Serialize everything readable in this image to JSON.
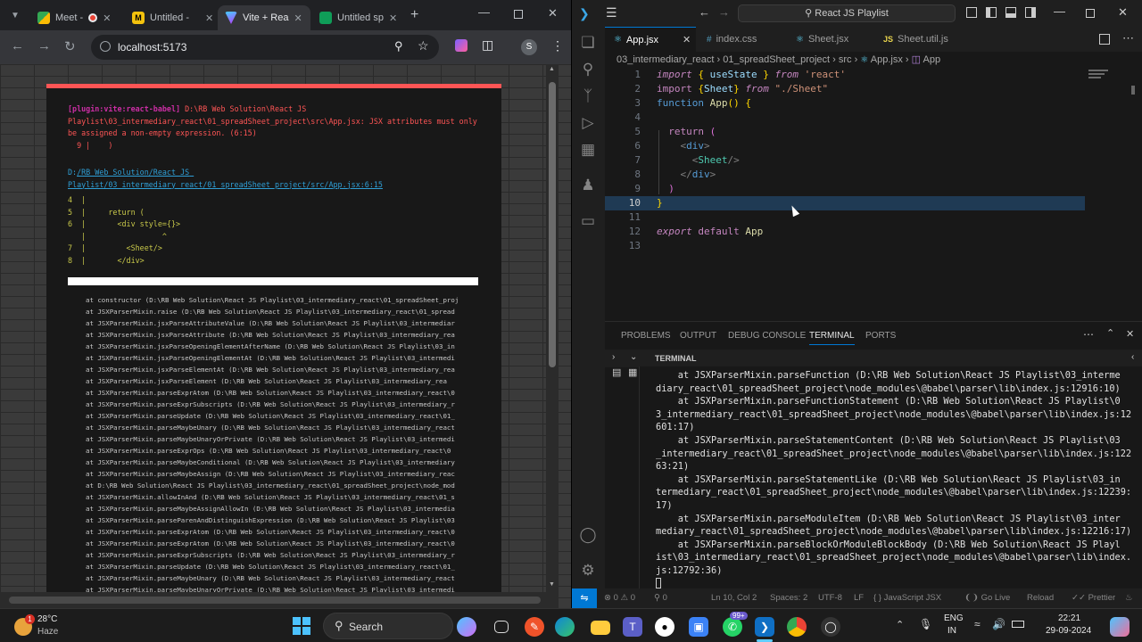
{
  "browser": {
    "tabs": [
      {
        "label": "Meet -",
        "icon": "meet-icon",
        "rec": true
      },
      {
        "label": "Untitled -",
        "icon": "untitled-icon"
      },
      {
        "label": "Vite + Rea",
        "icon": "vite-icon",
        "active": true
      },
      {
        "label": "Untitled sp",
        "icon": "sheets-icon"
      }
    ],
    "url": "localhost:5173",
    "profile": "S",
    "error": {
      "plugin": "[plugin:vite:react-babel]",
      "message": " D:\\RB Web Solution\\React JS Playlist\\03_intermediary_react\\01_spreadSheet_project\\src\\App.jsx: JSX attributes must only be assigned a non-empty expression. (6:15)\n  9 |    )",
      "file_prefix": "D:",
      "file_link": "/RB Web Solution/React JS Playlist/03_intermediary_react/01_spreadSheet_project/src/App.jsx:6:15",
      "frame": "4  |\n5  |     return (\n6  |       <div style={}>\n   |                 ^\n7  |         <Sheet/>\n8  |       </div>",
      "stack": [
        "at constructor (D:\\RB Web Solution\\React JS Playlist\\03_intermediary_react\\01_spreadSheet_proj",
        "at JSXParserMixin.raise (D:\\RB Web Solution\\React JS Playlist\\03_intermediary_react\\01_spread",
        "at JSXParserMixin.jsxParseAttributeValue (D:\\RB Web Solution\\React JS Playlist\\03_intermediar",
        "at JSXParserMixin.jsxParseAttribute (D:\\RB Web Solution\\React JS Playlist\\03_intermediary_rea",
        "at JSXParserMixin.jsxParseOpeningElementAfterName (D:\\RB Web Solution\\React JS Playlist\\03_in",
        "at JSXParserMixin.jsxParseOpeningElementAt (D:\\RB Web Solution\\React JS Playlist\\03_intermedi",
        "at JSXParserMixin.jsxParseElementAt (D:\\RB Web Solution\\React JS Playlist\\03_intermediary_rea",
        "at JSXParserMixin.jsxParseElement (D:\\RB Web Solution\\React JS Playlist\\03_intermediary_rea",
        "at JSXParserMixin.parseExprAtom (D:\\RB Web Solution\\React JS Playlist\\03_intermediary_react\\0",
        "at JSXParserMixin.parseExprSubscripts (D:\\RB Web Solution\\React JS Playlist\\03_intermediary_r",
        "at JSXParserMixin.parseUpdate (D:\\RB Web Solution\\React JS Playlist\\03_intermediary_react\\01_",
        "at JSXParserMixin.parseMaybeUnary (D:\\RB Web Solution\\React JS Playlist\\03_intermediary_react",
        "at JSXParserMixin.parseMaybeUnaryOrPrivate (D:\\RB Web Solution\\React JS Playlist\\03_intermedi",
        "at JSXParserMixin.parseExprOps (D:\\RB Web Solution\\React JS Playlist\\03_intermediary_react\\0",
        "at JSXParserMixin.parseMaybeConditional (D:\\RB Web Solution\\React JS Playlist\\03_intermediary",
        "at JSXParserMixin.parseMaybeAssign (D:\\RB Web Solution\\React JS Playlist\\03_intermediary_reac",
        "at D:\\RB Web Solution\\React JS Playlist\\03_intermediary_react\\01_spreadSheet_project\\node_mod",
        "at JSXParserMixin.allowInAnd (D:\\RB Web Solution\\React JS Playlist\\03_intermediary_react\\01_s",
        "at JSXParserMixin.parseMaybeAssignAllowIn (D:\\RB Web Solution\\React JS Playlist\\03_intermedia",
        "at JSXParserMixin.parseParenAndDistinguishExpression (D:\\RB Web Solution\\React JS Playlist\\03",
        "at JSXParserMixin.parseExprAtom (D:\\RB Web Solution\\React JS Playlist\\03_intermediary_react\\0",
        "at JSXParserMixin.parseExprAtom (D:\\RB Web Solution\\React JS Playlist\\03_intermediary_react\\0",
        "at JSXParserMixin.parseExprSubscripts (D:\\RB Web Solution\\React JS Playlist\\03_intermediary_r",
        "at JSXParserMixin.parseUpdate (D:\\RB Web Solution\\React JS Playlist\\03_intermediary_react\\01_",
        "at JSXParserMixin.parseMaybeUnary (D:\\RB Web Solution\\React JS Playlist\\03_intermediary_react",
        "at JSXParserMixin.parseMaybeUnaryOrPrivate (D:\\RB Web Solution\\React JS Playlist\\03_intermedi"
      ]
    }
  },
  "vscode": {
    "search": "React JS Playlist",
    "tabs": [
      {
        "label": "App.jsx",
        "icon": "react-icon",
        "active": true
      },
      {
        "label": "index.css",
        "icon": "css-icon"
      },
      {
        "label": "Sheet.jsx",
        "icon": "react-icon"
      },
      {
        "label": "Sheet.util.js",
        "icon": "js-icon"
      }
    ],
    "breadcrumbs": [
      "03_intermediary_react",
      "01_spreadSheet_project",
      "src",
      "App.jsx",
      "App"
    ],
    "code_lines": [
      "1",
      "2",
      "3",
      "4",
      "5",
      "6",
      "7",
      "8",
      "9",
      "10",
      "11",
      "12",
      "13"
    ],
    "current_line": "10",
    "panel_tabs": [
      "PROBLEMS",
      "OUTPUT",
      "DEBUG CONSOLE",
      "TERMINAL",
      "PORTS"
    ],
    "active_panel": "TERMINAL",
    "terminal_title": "TERMINAL",
    "terminal": "    at JSXParserMixin.parseFunction (D:\\RB Web Solution\\React JS Playlist\\03_interme\ndiary_react\\01_spreadSheet_project\\node_modules\\@babel\\parser\\lib\\index.js:12916:10)\n    at JSXParserMixin.parseFunctionStatement (D:\\RB Web Solution\\React JS Playlist\\0\n3_intermediary_react\\01_spreadSheet_project\\node_modules\\@babel\\parser\\lib\\index.js:12\n601:17)\n    at JSXParserMixin.parseStatementContent (D:\\RB Web Solution\\React JS Playlist\\03\n_intermediary_react\\01_spreadSheet_project\\node_modules\\@babel\\parser\\lib\\index.js:122\n63:21)\n    at JSXParserMixin.parseStatementLike (D:\\RB Web Solution\\React JS Playlist\\03_in\ntermediary_react\\01_spreadSheet_project\\node_modules\\@babel\\parser\\lib\\index.js:12239:\n17)\n    at JSXParserMixin.parseModuleItem (D:\\RB Web Solution\\React JS Playlist\\03_inter\nmediary_react\\01_spreadSheet_project\\node_modules\\@babel\\parser\\lib\\index.js:12216:17)\n    at JSXParserMixin.parseBlockOrModuleBlockBody (D:\\RB Web Solution\\React JS Playl\nist\\03_intermediary_react\\01_spreadSheet_project\\node_modules\\@babel\\parser\\lib\\index.\njs:12792:36)",
    "status": {
      "errors": "0",
      "warnings": "0",
      "ports": "0",
      "position": "Ln 10, Col 2",
      "spaces": "Spaces: 2",
      "encoding": "UTF-8",
      "eol": "LF",
      "language": "JavaScript JSX",
      "golive": "Go Live",
      "reload": "Reload",
      "prettier": "Prettier"
    }
  },
  "taskbar": {
    "weather_temp": "28°C",
    "weather_desc": "Haze",
    "weather_badge": "1",
    "search": "Search",
    "badge": "99+",
    "lang1": "ENG",
    "lang2": "IN",
    "time": "22:21",
    "date": "29-09-2024"
  }
}
